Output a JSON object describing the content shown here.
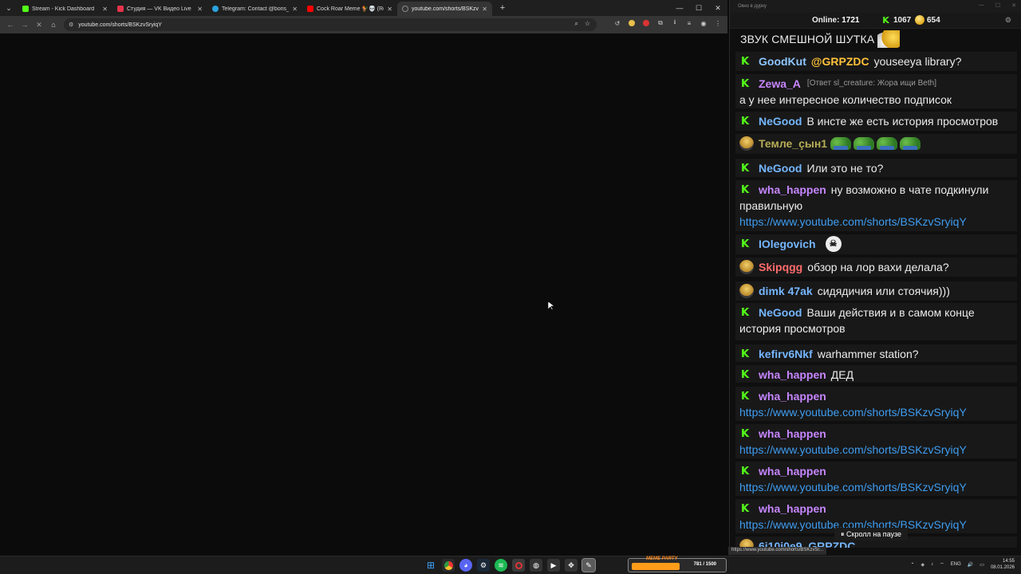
{
  "browser": {
    "tabs": [
      {
        "title": "Stream - Kick Dashboard",
        "color": "#53fc18",
        "active": false
      },
      {
        "title": "Студия — VK Видео Live",
        "color": "#e5334b",
        "active": false
      },
      {
        "title": "Telegram: Contact @boris_roch",
        "color": "#2aa3df",
        "active": false
      },
      {
        "title": "Cock Roar Meme 🐓💀 (Roosts",
        "color": "#ff0000",
        "active": false
      },
      {
        "title": "youtube.com/shorts/BSKzvSryi",
        "color": "#7a7a7a",
        "active": true
      }
    ],
    "url": "youtube.com/shorts/BSKzvSryiqY",
    "status_url": "https://www.youtube.com/shorts/BSKzvSr..."
  },
  "chat": {
    "window_title": "Окно в дурку",
    "online_label": "Online:",
    "online_count": "1721",
    "kick_count": "1067",
    "gold_count": "654",
    "pause_label": "⏸ Скролл на паузе",
    "messages": [
      {
        "badge": "none",
        "user": "",
        "user_color": "#ffffff",
        "text": "ЗВУК СМЕШНОЙ ШУТКА",
        "emote": "gold"
      },
      {
        "badge": "kick",
        "user": "GoodKut",
        "user_color": "#8ec6ff",
        "mention": "@GRPZDC",
        "text": "youseeya library?"
      },
      {
        "badge": "kick",
        "user": "Zewa_A",
        "user_color": "#c686ff",
        "reply": "[Ответ sl_creature: Жора ищи Beth]",
        "text2": "а у нее интересное количество подписок"
      },
      {
        "badge": "kick",
        "user": "NeGood",
        "user_color": "#75b6ff",
        "text": "В инсте же есть история просмотров"
      },
      {
        "badge": "emote",
        "user": "Темле_çын1",
        "user_color": "#b6ad55",
        "emote": "pepes"
      },
      {
        "badge": "kick",
        "user": "NeGood",
        "user_color": "#75b6ff",
        "text": "Или это не то?"
      },
      {
        "badge": "kick",
        "user": "wha_happen",
        "user_color": "#c686ff",
        "text": "ну возможно в чате подкинули",
        "text2": "правильную",
        "link": "https://www.youtube.com/shorts/BSKzvSryiqY"
      },
      {
        "badge": "kick",
        "user": "IOlegovich",
        "user_color": "#75b6ff",
        "emote": "skull"
      },
      {
        "badge": "emote",
        "user": "Skipqgg",
        "user_color": "#ff6b6b",
        "text": "обзор на лор вахи делала?"
      },
      {
        "badge": "emote",
        "user": "dimk 47ak",
        "user_color": "#75b6ff",
        "text": "сидядичия или стоячия)))"
      },
      {
        "badge": "kick",
        "user": "NeGood",
        "user_color": "#75b6ff",
        "text": "Ваши действия и в самом конце",
        "text2": "история просмотров"
      },
      {
        "badge": "kick",
        "user": "kefirv6Nkf",
        "user_color": "#75b6ff",
        "text": "warhammer station?"
      },
      {
        "badge": "kick",
        "user": "wha_happen",
        "user_color": "#c686ff",
        "text": "ДЕД"
      },
      {
        "badge": "kick",
        "user": "wha_happen",
        "user_color": "#c686ff",
        "link": "https://www.youtube.com/shorts/BSKzvSryiqY"
      },
      {
        "badge": "kick",
        "user": "wha_happen",
        "user_color": "#c686ff",
        "link": "https://www.youtube.com/shorts/BSKzvSryiqY"
      },
      {
        "badge": "kick",
        "user": "wha_happen",
        "user_color": "#c686ff",
        "link": "https://www.youtube.com/shorts/BSKzvSryiqY"
      },
      {
        "badge": "kick",
        "user": "wha_happen",
        "user_color": "#c686ff",
        "link": "https://www.youtube.com/shorts/BSKzvSryiqY"
      },
      {
        "badge": "emote",
        "user": "6i10i0e9_GRPZDC",
        "user_color": "#75b6ff"
      }
    ]
  },
  "taskbar": {
    "meme_label": "MEME PARTY",
    "meme_count": "781 / 1500",
    "lang": "ENG",
    "time": "14:55",
    "date": "08.01.2026"
  }
}
